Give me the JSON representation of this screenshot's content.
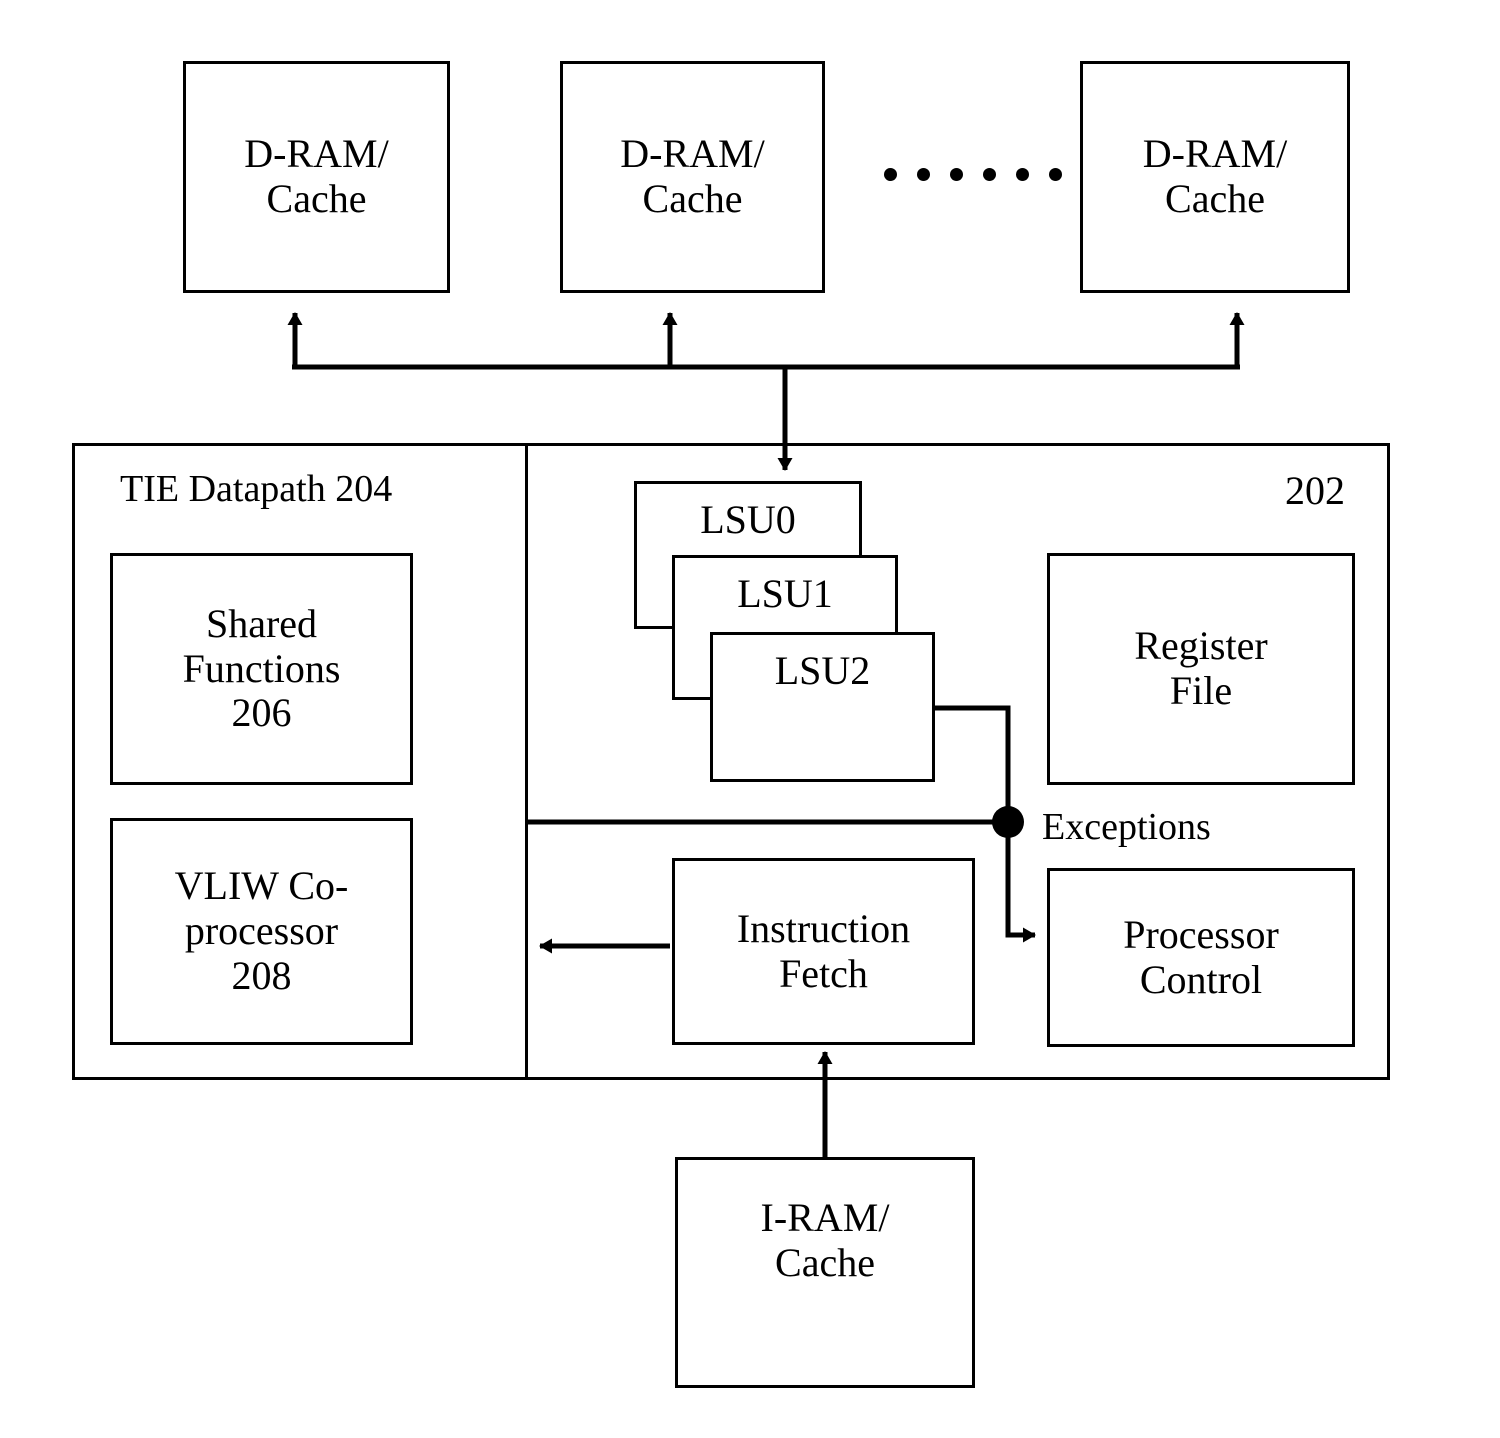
{
  "diagram": {
    "figure_ref": "202",
    "memory_row": {
      "boxes": [
        {
          "line1": "D-RAM/",
          "line2": "Cache"
        },
        {
          "line1": "D-RAM/",
          "line2": "Cache"
        },
        {
          "line1": "D-RAM/",
          "line2": "Cache"
        }
      ],
      "ellipsis_dot_count": 6
    },
    "processor": {
      "id_label": "202",
      "tie_datapath": {
        "title": "TIE Datapath 204",
        "blocks": [
          {
            "line1": "Shared",
            "line2": "Functions",
            "line3": "206"
          },
          {
            "line1": "VLIW Co-",
            "line2": "processor",
            "line3": "208"
          }
        ]
      },
      "lsu_stack": [
        {
          "label": "LSU0"
        },
        {
          "label": "LSU1"
        },
        {
          "label": "LSU2"
        }
      ],
      "register_file": {
        "line1": "Register",
        "line2": "File"
      },
      "exceptions_label": "Exceptions",
      "processor_control": {
        "line1": "Processor",
        "line2": "Control"
      },
      "instruction_fetch": {
        "line1": "Instruction",
        "line2": "Fetch"
      }
    },
    "instruction_memory": {
      "line1": "I-RAM/",
      "line2": "Cache"
    },
    "colors": {
      "stroke": "#000000",
      "background": "#ffffff"
    }
  }
}
